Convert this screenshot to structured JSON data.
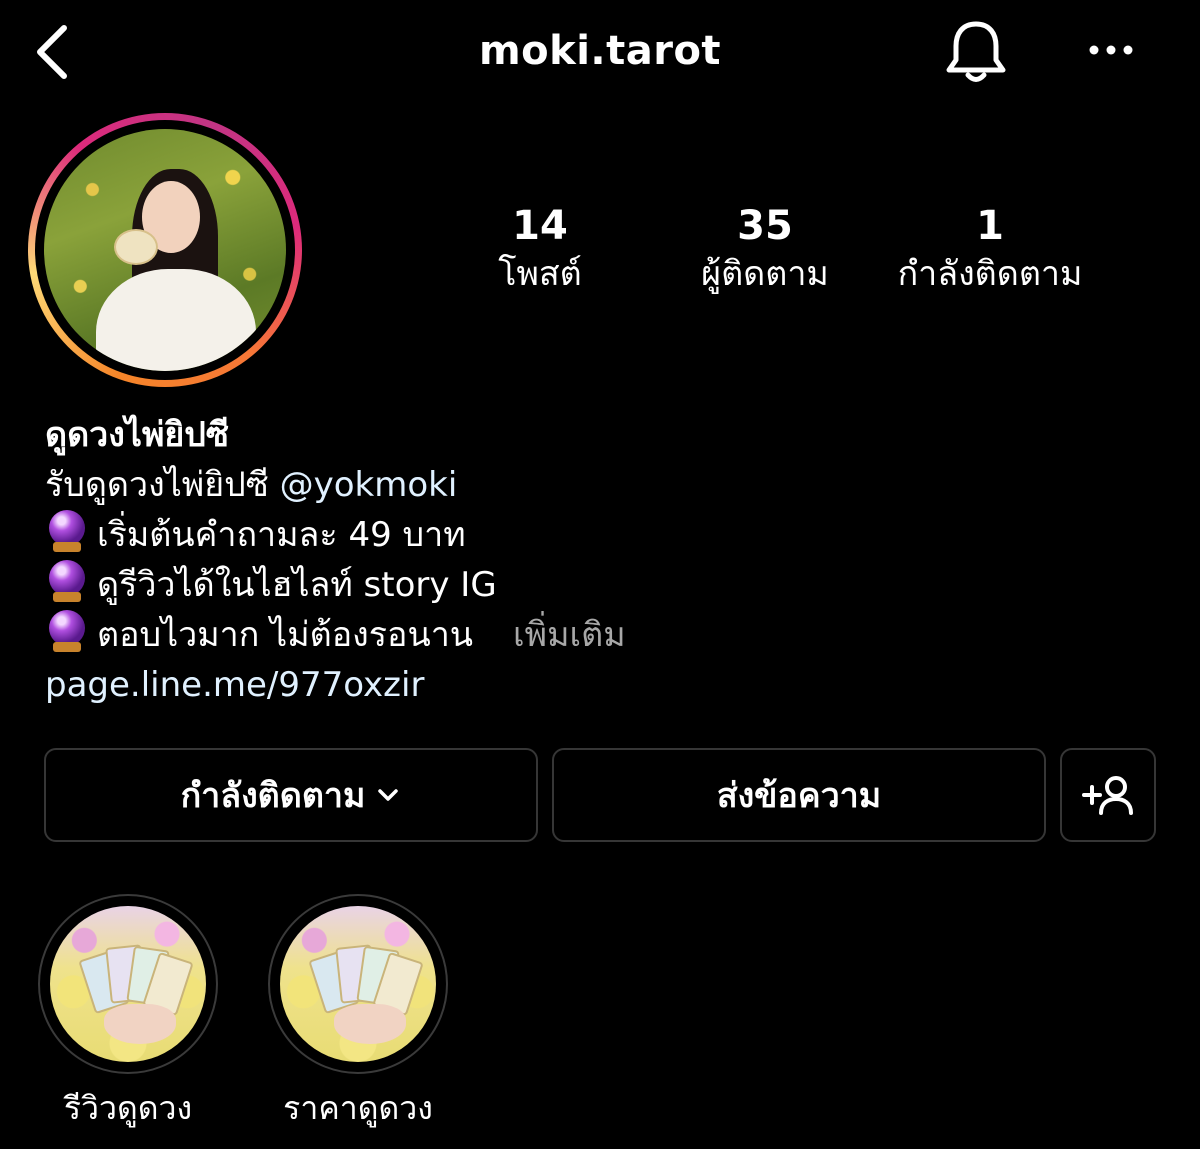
{
  "header": {
    "title": "moki.tarot",
    "back_icon": "chevron-left-icon",
    "bell_icon": "bell-icon",
    "more_icon": "more-horizontal-icon"
  },
  "stats": {
    "posts": {
      "count": "14",
      "label": "โพสต์"
    },
    "followers": {
      "count": "35",
      "label": "ผู้ติดตาม"
    },
    "following": {
      "count": "1",
      "label": "กำลังติดตาม"
    }
  },
  "bio": {
    "name": "ดูดวงไพ่ยิปซี",
    "line1_text": "รับดูดวงไพ่ยิปซี ",
    "line1_mention": "@yokmoki",
    "line2": "เริ่มต้นคำถามละ 49 บาท",
    "line3": "ดูรีวิวได้ในไฮไลท์ story IG",
    "line4": "ตอบไวมาก ไม่ต้องรอนาน",
    "more": "เพิ่มเติม",
    "link": "page.line.me/977oxzir",
    "emoji_icon": "crystal-ball-icon"
  },
  "buttons": {
    "following": "กำลังติดตาม",
    "message": "ส่งข้อความ",
    "add_user_icon": "add-user-icon"
  },
  "highlights": [
    {
      "label": "รีวิวดูดวง"
    },
    {
      "label": "ราคาดูดวง"
    }
  ],
  "colors": {
    "background": "#000000",
    "text": "#ffffff",
    "link": "#e0f1ff",
    "muted": "#a8a8a8",
    "button_border": "#363636"
  }
}
